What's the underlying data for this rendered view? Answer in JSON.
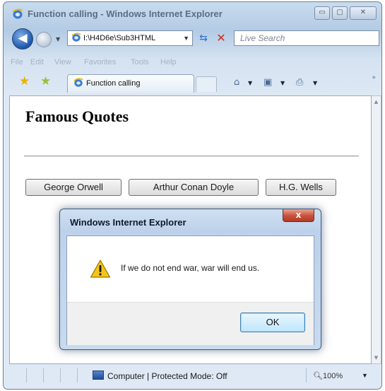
{
  "window": {
    "title": "Function calling - Windows Internet Explorer",
    "min_glyph": "▭",
    "max_glyph": "▢",
    "close_glyph": "✕"
  },
  "nav": {
    "address": "I:\\H4D6e\\Sub3HTML",
    "search_placeholder": "Live Search"
  },
  "menu": {
    "items": [
      "File",
      "Edit",
      "View",
      "Favorites",
      "Tools",
      "Help"
    ]
  },
  "tabs": [
    {
      "label": "Function calling"
    }
  ],
  "page": {
    "heading": "Famous Quotes",
    "buttons": [
      "George Orwell",
      "Arthur Conan Doyle",
      "H.G. Wells"
    ]
  },
  "dialog": {
    "title": "Windows Internet Explorer",
    "close_glyph": "x",
    "message": "If we do not end war, war will end us.",
    "ok_label": "OK"
  },
  "status": {
    "zone_text": "Computer | Protected Mode: Off",
    "zoom": "100%"
  },
  "icons": {
    "ie": "ie-logo-icon",
    "back": "back-arrow-icon",
    "forward": "forward-arrow-icon",
    "refresh": "refresh-icon",
    "stop": "stop-icon",
    "favorites": "favorites-star-icon",
    "add_favorites": "add-favorites-icon",
    "home": "home-icon",
    "feeds": "feeds-icon",
    "print": "print-icon",
    "warning": "warning-icon",
    "zone": "computer-zone-icon",
    "zoom": "zoom-icon"
  },
  "colors": {
    "chrome_blue": "#b3cbe4",
    "close_red": "#c8503a",
    "ok_blue": "#bee6fd"
  }
}
